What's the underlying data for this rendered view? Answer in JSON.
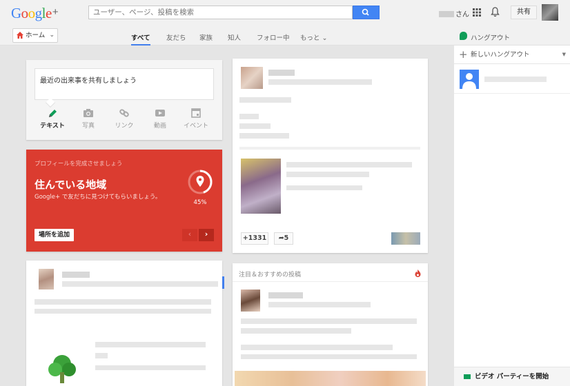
{
  "header": {
    "logo_text": "Google",
    "logo_plus": "+",
    "search_placeholder": "ユーザー、ページ、投稿を検索",
    "user_suffix": "さん",
    "share_label": "共有"
  },
  "nav": {
    "home_label": "ホーム",
    "tabs": [
      "すべて",
      "友だち",
      "家族",
      "知人",
      "フォロー中",
      "もっと"
    ],
    "hangouts_label": "ハングアウト"
  },
  "share_box": {
    "placeholder": "最近の出来事を共有しましょう",
    "options": [
      {
        "label": "テキスト",
        "icon": "pencil-icon"
      },
      {
        "label": "写真",
        "icon": "camera-icon"
      },
      {
        "label": "リンク",
        "icon": "link-icon"
      },
      {
        "label": "動画",
        "icon": "video-icon"
      },
      {
        "label": "イベント",
        "icon": "event-icon"
      }
    ]
  },
  "profile_card": {
    "subtitle": "プロフィールを完成させましょう",
    "title": "住んでいる地域",
    "description": "Google+ で友だちに見つけてもらいましょう。",
    "progress": 45,
    "progress_label": "45%",
    "add_button": "場所を追加",
    "prev": "‹",
    "next": "›"
  },
  "post": {
    "plus_count": "+1331",
    "reshare_count": "5"
  },
  "trending": {
    "title": "注目＆おすすめの投稿"
  },
  "right_panel": {
    "new_hangout_label": "新しいハングアウト",
    "video_party_label": "ビデオ パーティーを開始"
  },
  "colors": {
    "accent_blue": "#4285f4",
    "profile_red": "#db3c30",
    "hangouts_green": "#0f9d58"
  }
}
